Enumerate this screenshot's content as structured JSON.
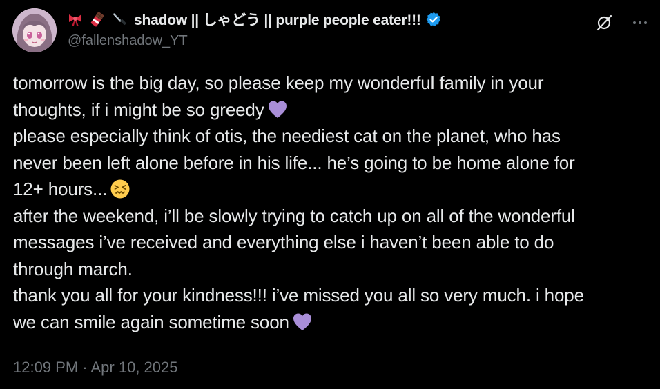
{
  "author": {
    "display_name": "shadow || しゃどう || purple people eater!!!",
    "handle": "@fallenshadow_YT",
    "verified": true,
    "avatar_icon": "anime-avatar",
    "name_emojis": [
      "ribbon-emoji",
      "chocolate-bar-emoji",
      "knife-emoji"
    ]
  },
  "actions": {
    "grok_icon": "grok-icon",
    "more_icon": "more-icon"
  },
  "tweet": {
    "lines": [
      "tomorrow is the big day, so please keep my wonderful family in your",
      "thoughts, if i might be so greedy",
      "please especially think of otis, the neediest cat on the planet, who has",
      "never been left alone before in his life... he’s going to be home alone for",
      "12+ hours...",
      "after the weekend, i’ll be slowly trying to catch up on all of the wonderful",
      "messages i’ve received and everything else i haven’t been able to do",
      "through march.",
      "thank you all for your kindness!!! i’ve missed you all so very much. i hope",
      "we can smile again sometime soon"
    ],
    "timestamp": "12:09 PM · Apr 10, 2025"
  },
  "colors": {
    "background": "#000000",
    "text": "#e7e9ea",
    "secondary": "#71767b",
    "verified": "#1d9bf0",
    "heart": "#a98ed8",
    "emoji_face": "#ffcc4d"
  }
}
